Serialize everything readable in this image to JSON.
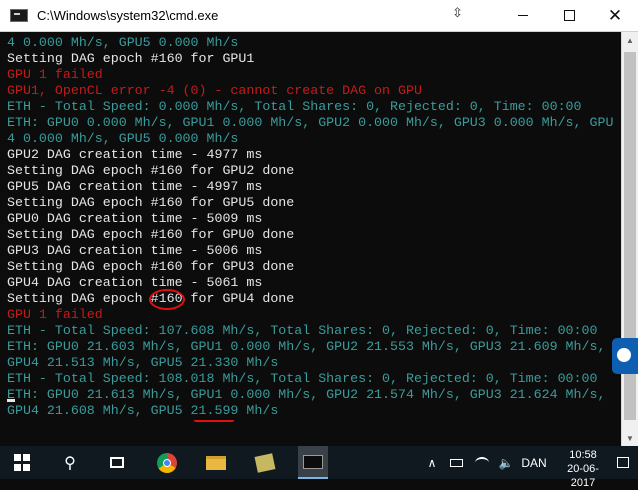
{
  "window": {
    "title": "C:\\Windows\\system32\\cmd.exe",
    "app_icon": "cmd-icon",
    "move_icon": "⇳",
    "minimize_icon": "minimize-icon",
    "maximize_icon": "maximize-icon",
    "close_label": "✕"
  },
  "console": {
    "background": "#0c0c0c",
    "colors": {
      "white": "#e6e6e6",
      "cyan": "#3a9c9c",
      "red": "#c41b1b"
    },
    "lines": [
      {
        "text": "4 0.000 Mh/s, GPU5 0.000 Mh/s",
        "color": "cyan"
      },
      {
        "text": "Setting DAG epoch #160 for GPU1",
        "color": "white"
      },
      {
        "text": "GPU 1 failed",
        "color": "red"
      },
      {
        "text": "GPU1, OpenCL error -4 (0) - cannot create DAG on GPU",
        "color": "red"
      },
      {
        "text": "ETH - Total Speed: 0.000 Mh/s, Total Shares: 0, Rejected: 0, Time: 00:00",
        "color": "cyan"
      },
      {
        "text": "ETH: GPU0 0.000 Mh/s, GPU1 0.000 Mh/s, GPU2 0.000 Mh/s, GPU3 0.000 Mh/s, GPU",
        "color": "cyan"
      },
      {
        "text": "4 0.000 Mh/s, GPU5 0.000 Mh/s",
        "color": "cyan"
      },
      {
        "text": "GPU2 DAG creation time - 4977 ms",
        "color": "white"
      },
      {
        "text": "Setting DAG epoch #160 for GPU2 done",
        "color": "white"
      },
      {
        "text": "GPU5 DAG creation time - 4997 ms",
        "color": "white"
      },
      {
        "text": "Setting DAG epoch #160 for GPU5 done",
        "color": "white"
      },
      {
        "text": "GPU0 DAG creation time - 5009 ms",
        "color": "white"
      },
      {
        "text": "Setting DAG epoch #160 for GPU0 done",
        "color": "white"
      },
      {
        "text": "GPU3 DAG creation time - 5006 ms",
        "color": "white"
      },
      {
        "text": "Setting DAG epoch #160 for GPU3 done",
        "color": "white"
      },
      {
        "text": "GPU4 DAG creation time - 5061 ms",
        "color": "white"
      },
      {
        "text": "Setting DAG epoch #160 for GPU4 done",
        "color": "white"
      },
      {
        "text": "GPU 1 failed",
        "color": "red"
      },
      {
        "text": "ETH - Total Speed: 107.608 Mh/s, Total Shares: 0, Rejected: 0, Time: 00:00",
        "color": "cyan"
      },
      {
        "text": "ETH: GPU0 21.603 Mh/s, GPU1 0.000 Mh/s, GPU2 21.553 Mh/s, GPU3 21.609 Mh/s,",
        "color": "cyan"
      },
      {
        "text": "GPU4 21.513 Mh/s, GPU5 21.330 Mh/s",
        "color": "cyan"
      },
      {
        "text": "ETH - Total Speed: 108.018 Mh/s, Total Shares: 0, Rejected: 0, Time: 00:00",
        "color": "cyan"
      },
      {
        "text": "ETH: GPU0 21.613 Mh/s, GPU1 0.000 Mh/s, GPU2 21.574 Mh/s, GPU3 21.624 Mh/s,",
        "color": "cyan"
      },
      {
        "text": "GPU4 21.608 Mh/s, GPU5 21.599 Mh/s",
        "color": "cyan"
      }
    ]
  },
  "annotations": {
    "circle_color": "#e01010",
    "circled_text": "#160",
    "underlined_text": "21.599"
  },
  "scrollbar": {
    "up_arrow": "▲",
    "down_arrow": "▼"
  },
  "taskbar": {
    "background": "#101820",
    "search_icon": "⚲",
    "tray_chevron": "∧",
    "volume_icon": "🔈",
    "language": "DAN",
    "time": "10:58",
    "date": "20-06-2017"
  }
}
